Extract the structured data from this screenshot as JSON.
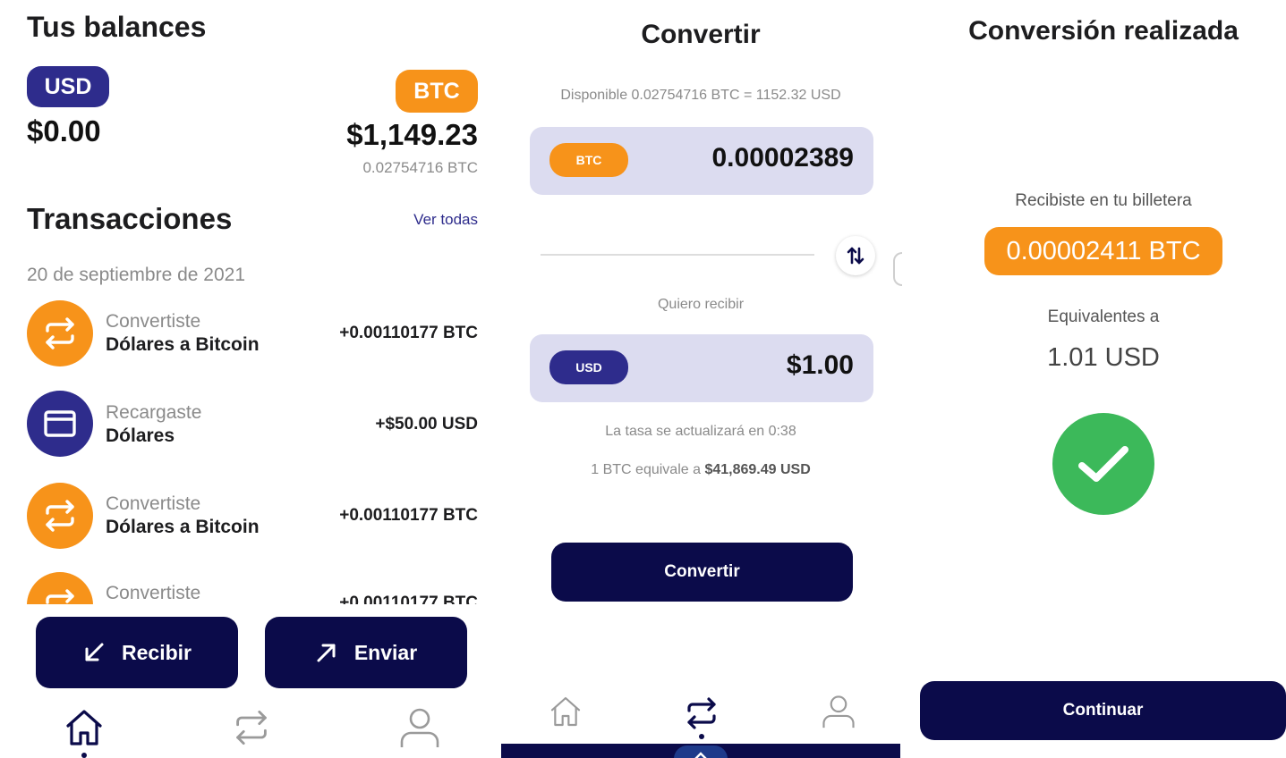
{
  "balances": {
    "title": "Tus balances",
    "usd": {
      "label": "USD",
      "amount": "$0.00"
    },
    "btc": {
      "label": "BTC",
      "amount": "$1,149.23",
      "sub": "0.02754716 BTC"
    }
  },
  "transactions": {
    "title": "Transacciones",
    "see_all": "Ver todas",
    "date": "20 de septiembre de 2021",
    "items": [
      {
        "sub": "Convertiste",
        "main": "Dólares a Bitcoin",
        "amount": "+0.00110177 BTC",
        "icon": "convert-icon",
        "color": "#f7931a"
      },
      {
        "sub": "Recargaste",
        "main": "Dólares",
        "amount": "+$50.00 USD",
        "icon": "card-icon",
        "color": "#2e2c8c"
      },
      {
        "sub": "Convertiste",
        "main": "Dólares a Bitcoin",
        "amount": "+0.00110177 BTC",
        "icon": "convert-icon",
        "color": "#f7931a"
      },
      {
        "sub": "Convertiste",
        "main": "",
        "amount": "+0.00110177 BTC",
        "icon": "convert-icon",
        "color": "#f7931a"
      }
    ]
  },
  "actions": {
    "receive": "Recibir",
    "send": "Enviar"
  },
  "convert": {
    "title": "Convertir",
    "available": "Disponible 0.02754716 BTC = 1152.32 USD",
    "from": {
      "currency": "BTC",
      "value": "0.00002389"
    },
    "receive_label": "Quiero recibir",
    "to": {
      "currency": "USD",
      "value": "$1.00"
    },
    "rate_update": "La tasa se actualizará en 0:38",
    "rate_prefix": "1 BTC equivale a ",
    "rate_value": "$41,869.49 USD",
    "button": "Convertir"
  },
  "done": {
    "title": "Conversión realizada",
    "received_label": "Recibiste en tu billetera",
    "received_amount": "0.00002411 BTC",
    "equiv_label": "Equivalentes a",
    "equiv_value": "1.01 USD",
    "button": "Continuar"
  },
  "colors": {
    "navy": "#0b0b4a",
    "indigo": "#2e2c8c",
    "orange": "#f7931a",
    "green": "#3cb95a",
    "box": "#dcdcf0"
  }
}
